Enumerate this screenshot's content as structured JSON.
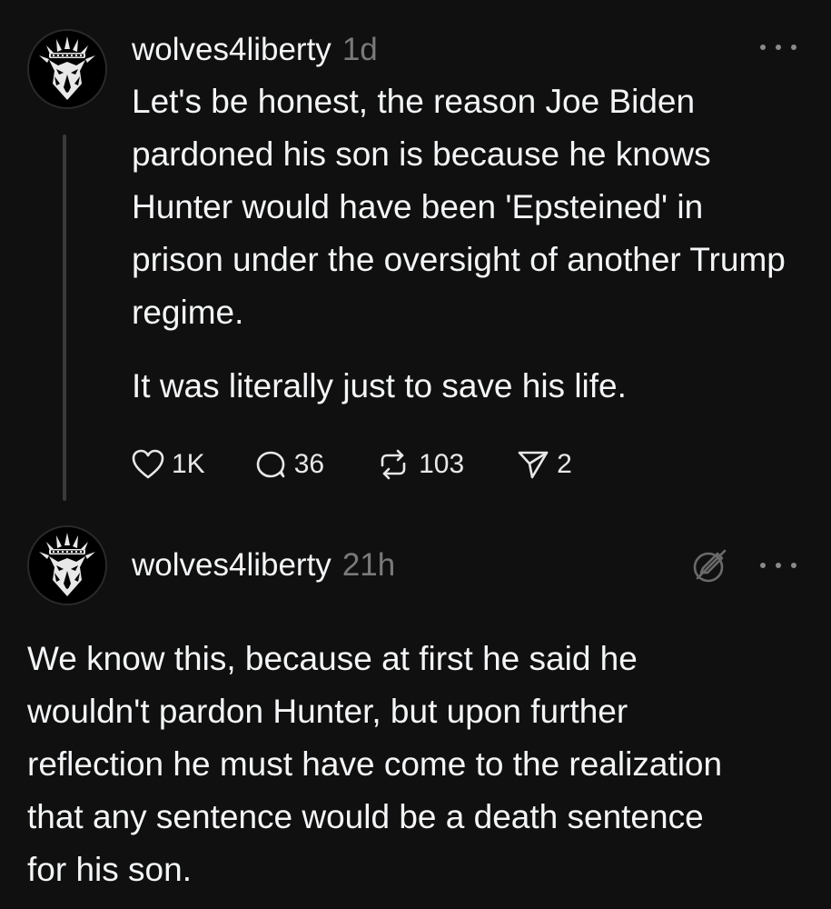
{
  "posts": [
    {
      "username": "wolves4liberty",
      "timestamp": "1d",
      "paragraphs": [
        "Let's be honest, the reason Joe Biden pardoned his son is because he knows Hunter would have been 'Epsteined' in prison under the oversight of another Trump regime.",
        "It was literally just to save his life."
      ],
      "actions": {
        "likes": "1K",
        "replies": "36",
        "reposts": "103",
        "shares": "2"
      }
    },
    {
      "username": "wolves4liberty",
      "timestamp": "21h",
      "paragraphs": [
        "We know this, because at first he said he wouldn't pardon Hunter, but upon further reflection he must have come to the realization that any sentence would be a death sentence for his son."
      ]
    }
  ],
  "icons": {
    "avatar": "wolf-liberty-crown-logo",
    "more": "more-horizontal-icon",
    "like": "heart-icon",
    "reply": "speech-bubble-icon",
    "repost": "repost-arrows-icon",
    "share": "paper-plane-icon",
    "no_reply": "pencil-slash-icon"
  },
  "colors": {
    "background": "#101010",
    "text": "#f3f5f7",
    "muted": "#7a7a7a",
    "thread_line": "#3a3a3a"
  }
}
